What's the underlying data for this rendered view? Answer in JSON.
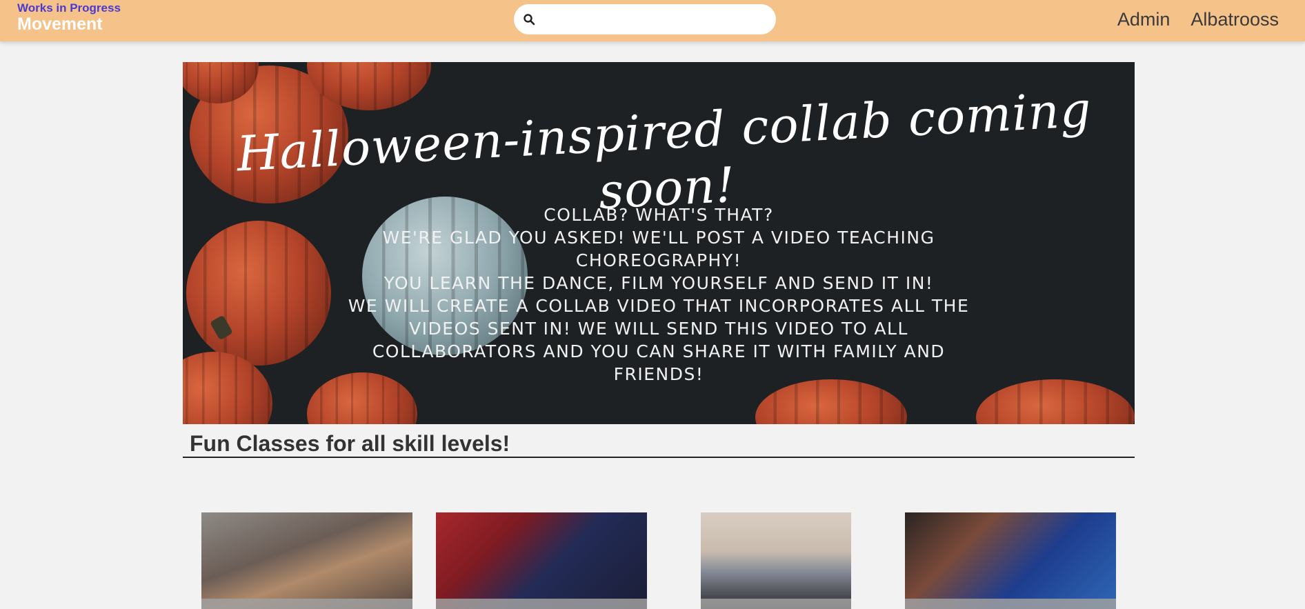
{
  "brand": {
    "top": "Works in Progress",
    "main": "Movement"
  },
  "search": {
    "placeholder": "",
    "value": ""
  },
  "nav": {
    "items": [
      "Admin",
      "Albatrooss"
    ]
  },
  "banner": {
    "headline": "Halloween-inspired collab coming soon!",
    "lines": [
      "COLLAB? WHAT'S THAT?",
      "WE'RE GLAD YOU ASKED! WE'LL POST A VIDEO TEACHING CHOREOGRAPHY!",
      "YOU LEARN THE DANCE, FILM YOURSELF AND SEND IT IN!",
      "WE WILL CREATE A COLLAB VIDEO THAT INCORPORATES ALL THE VIDEOS SENT IN! WE WILL SEND THIS VIDEO TO ALL COLLABORATORS AND YOU CAN SHARE IT WITH FAMILY AND FRIENDS!"
    ]
  },
  "section": {
    "title": "Fun Classes for all skill levels!"
  },
  "colors": {
    "navbar": "#f5c28a",
    "brand_top": "#4a3ad0",
    "brand_main": "#ffffff",
    "page_bg": "#f2f2f2",
    "banner_bg": "#1e2124"
  },
  "icons": {
    "search": "search-icon"
  }
}
